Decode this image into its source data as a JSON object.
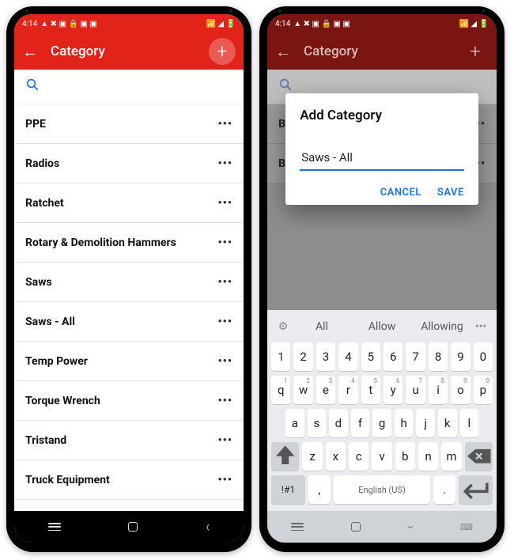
{
  "status": {
    "time": "4:14",
    "left_icons": "▲ ✖ ▣ 🔒 ▣ ▣",
    "right_icons": "📶 ◢ 🔋"
  },
  "appbar": {
    "back": "←",
    "title": "Category",
    "add": "+"
  },
  "search": {
    "icon": "🔍"
  },
  "left_list": [
    "PPE",
    "Radios",
    "Ratchet",
    "Rotary & Demolition Hammers",
    "Saws",
    "Saws - All",
    "Temp Power",
    "Torque Wrench",
    "Tristand",
    "Truck Equipment"
  ],
  "right_visible_rows": [
    "B",
    "Batteries"
  ],
  "more": "•••",
  "dialog": {
    "title": "Add Category",
    "value": "Saws - All",
    "cancel": "CANCEL",
    "save": "SAVE"
  },
  "keyboard": {
    "suggestions": [
      "All",
      "Allow",
      "Allowing"
    ],
    "sugg_more": "•••",
    "row_num": [
      "1",
      "2",
      "3",
      "4",
      "5",
      "6",
      "7",
      "8",
      "9",
      "0"
    ],
    "row_top": [
      "q",
      "w",
      "e",
      "r",
      "t",
      "y",
      "u",
      "i",
      "o",
      "p"
    ],
    "row_mid": [
      "a",
      "s",
      "d",
      "f",
      "g",
      "h",
      "j",
      "k",
      "l"
    ],
    "row_low": [
      "z",
      "x",
      "c",
      "v",
      "b",
      "n",
      "m"
    ],
    "sym": "!#1",
    "comma": ",",
    "space": "English (US)",
    "period": "."
  }
}
